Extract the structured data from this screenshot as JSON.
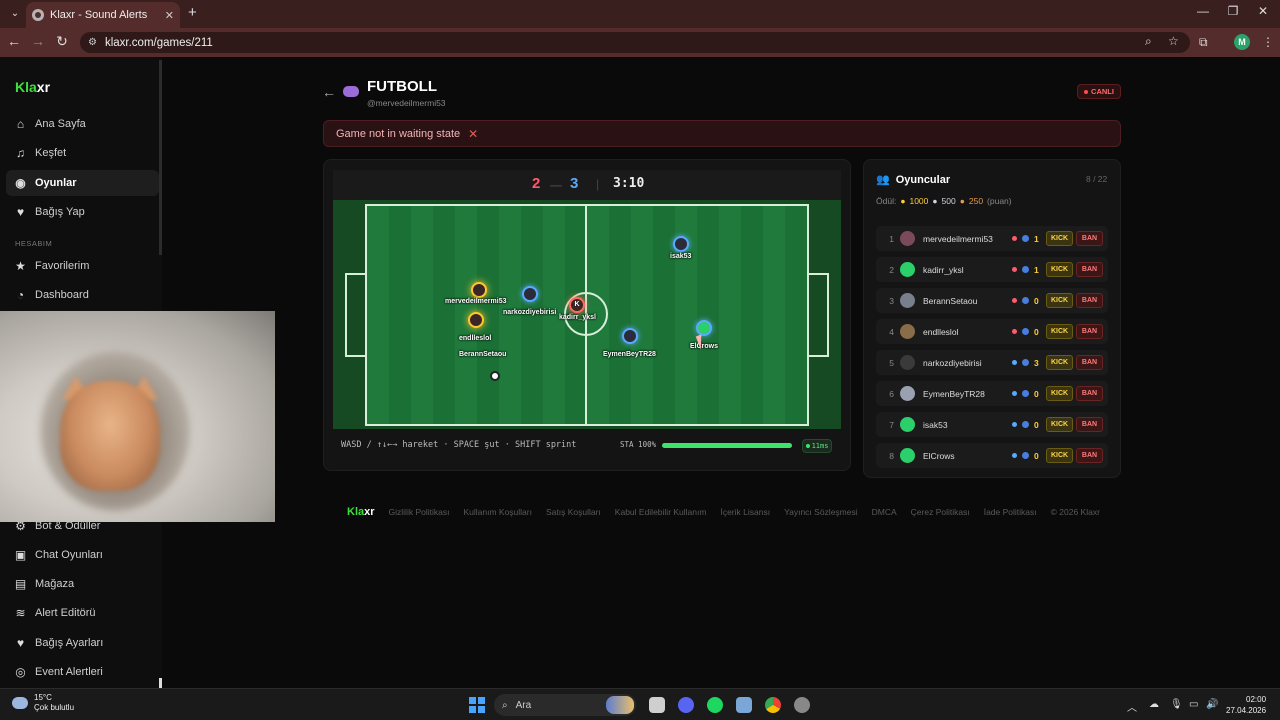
{
  "browser": {
    "tab_title": "Klaxr - Sound Alerts",
    "url": "klaxr.com/games/211",
    "profile_initial": "M"
  },
  "sidebar": {
    "logo_a": "Kla",
    "logo_b": "xr",
    "items": [
      {
        "label": "Ana Sayfa",
        "icon": "home-icon"
      },
      {
        "label": "Keşfet",
        "icon": "music-icon"
      },
      {
        "label": "Oyunlar",
        "icon": "gamepad-icon"
      },
      {
        "label": "Bağış Yap",
        "icon": "heart-icon"
      }
    ],
    "section_label": "HESABIM",
    "account_items": [
      {
        "label": "Favorilerim",
        "icon": "star-icon"
      },
      {
        "label": "Dashboard",
        "icon": "dashboard-icon"
      },
      {
        "label": "Bot & Ödüller",
        "icon": "bot-icon"
      },
      {
        "label": "Chat Oyunları",
        "icon": "chat-icon"
      },
      {
        "label": "Mağaza",
        "icon": "store-icon"
      },
      {
        "label": "Alert Editörü",
        "icon": "layers-icon"
      },
      {
        "label": "Bağış Ayarları",
        "icon": "heart-icon"
      },
      {
        "label": "Event Alertleri",
        "icon": "target-icon"
      }
    ]
  },
  "game": {
    "title": "FUTBOLL",
    "owner": "@mervedeilmermi53",
    "live_label": "CANLI",
    "alert_text": "Game not in waiting state",
    "score_red": "2",
    "score_blue": "3",
    "score_sep": "—",
    "divider": "|",
    "timer": "3:10",
    "hint": "WASD / ↑↓←→ hareket · SPACE şut · SHIFT sprint",
    "stamina_label": "STA 100%",
    "stamina": 1.0,
    "ping": "11ms",
    "field_players": [
      {
        "name": "mervedeilmermi53",
        "team": "red"
      },
      {
        "name": "narkozdiyebirisi",
        "team": "blue"
      },
      {
        "name": "kadirr_yksl",
        "team": "red"
      },
      {
        "name": "endlleslol",
        "team": "red"
      },
      {
        "name": "BerannSetaou",
        "team": "red"
      },
      {
        "name": "isak53",
        "team": "blue"
      },
      {
        "name": "EymenBeyTR28",
        "team": "blue"
      },
      {
        "name": "ElCrows",
        "team": "blue"
      }
    ],
    "kadirr_initial": "K"
  },
  "players_panel": {
    "title": "Oyuncular",
    "count": "8 / 22",
    "reward_label": "Ödül:",
    "reward_1": "1000",
    "reward_2": "500",
    "reward_3": "250",
    "reward_unit": "(puan)",
    "kick_label": "KICK",
    "ban_label": "BAN",
    "rows": [
      {
        "idx": "1",
        "name": "mervedeilmermi53",
        "team": "red",
        "score": "1",
        "avatar": "#7a4a5a"
      },
      {
        "idx": "2",
        "name": "kadirr_yksl",
        "team": "red",
        "score": "1",
        "avatar": "#2bd06b"
      },
      {
        "idx": "3",
        "name": "BerannSetaou",
        "team": "red",
        "score": "0",
        "avatar": "#7a7f8c"
      },
      {
        "idx": "4",
        "name": "endlleslol",
        "team": "red",
        "score": "0",
        "avatar": "#8a6b4a"
      },
      {
        "idx": "5",
        "name": "narkozdiyebirisi",
        "team": "blue",
        "score": "3",
        "avatar": "#3a3a3a"
      },
      {
        "idx": "6",
        "name": "EymenBeyTR28",
        "team": "blue",
        "score": "0",
        "avatar": "#9aa0b0"
      },
      {
        "idx": "7",
        "name": "isak53",
        "team": "blue",
        "score": "0",
        "avatar": "#2bd06b"
      },
      {
        "idx": "8",
        "name": "ElCrows",
        "team": "blue",
        "score": "0",
        "avatar": "#2bd06b"
      }
    ]
  },
  "footer": {
    "logo_a": "Kla",
    "logo_b": "xr",
    "links": [
      "Gizlilik Politikası",
      "Kullanım Koşulları",
      "Satış Koşulları",
      "Kabul Edilebilir Kullanım",
      "İçerik Lisansı",
      "Yayıncı Sözleşmesi",
      "DMCA",
      "Çerez Politikası",
      "İade Politikası",
      "© 2026 Klaxr"
    ]
  },
  "taskbar": {
    "temp": "15°C",
    "weather": "Çok bulutlu",
    "search_label": "Ara",
    "time": "02:00",
    "date": "27.04.2026"
  },
  "colors": {
    "accent": "#3de03d",
    "red_team": "#ff5a6e",
    "blue_team": "#5aa9ff"
  }
}
